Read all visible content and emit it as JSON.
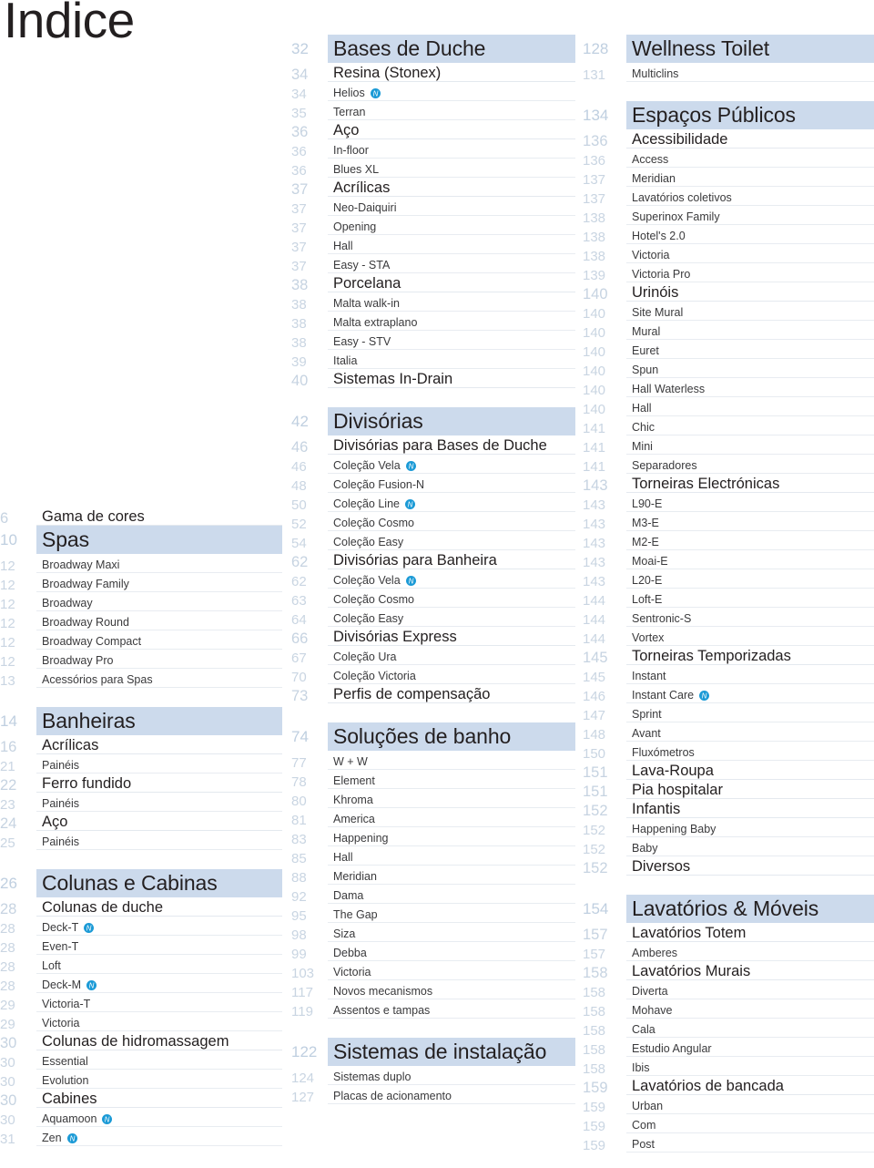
{
  "header": {
    "title": "Índice"
  },
  "theme": {
    "section_bar_color": "#ccdaec",
    "page_number_color": "#c6d3e1",
    "text_color": "#231f20",
    "rule_color": "#e6eaf0",
    "badge_color": "#1b9ad6",
    "badge_label": "N"
  },
  "columns": [
    {
      "name": "column-left",
      "rows": [
        {
          "type": "sub",
          "page": "6",
          "label": "Gama de cores",
          "size": "section-plain"
        },
        {
          "type": "section",
          "page": "10",
          "label": "Spas"
        },
        {
          "type": "item",
          "page": "12",
          "label": "Broadway Maxi"
        },
        {
          "type": "item",
          "page": "12",
          "label": "Broadway Family"
        },
        {
          "type": "item",
          "page": "12",
          "label": "Broadway"
        },
        {
          "type": "item",
          "page": "12",
          "label": "Broadway Round"
        },
        {
          "type": "item",
          "page": "12",
          "label": "Broadway Compact"
        },
        {
          "type": "item",
          "page": "12",
          "label": "Broadway Pro"
        },
        {
          "type": "item",
          "page": "13",
          "label": "Acessórios para Spas"
        },
        {
          "type": "gap"
        },
        {
          "type": "section",
          "page": "14",
          "label": "Banheiras"
        },
        {
          "type": "sub",
          "page": "16",
          "label": "Acrílicas"
        },
        {
          "type": "item",
          "page": "21",
          "label": "Painéis"
        },
        {
          "type": "sub",
          "page": "22",
          "label": "Ferro fundido"
        },
        {
          "type": "item",
          "page": "23",
          "label": "Painéis"
        },
        {
          "type": "sub",
          "page": "24",
          "label": "Aço"
        },
        {
          "type": "item",
          "page": "25",
          "label": "Painéis"
        },
        {
          "type": "gap"
        },
        {
          "type": "section",
          "page": "26",
          "label": "Colunas e Cabinas"
        },
        {
          "type": "sub",
          "page": "28",
          "label": "Colunas de duche"
        },
        {
          "type": "item",
          "page": "28",
          "label": "Deck-T",
          "badge": true
        },
        {
          "type": "item",
          "page": "28",
          "label": "Even-T"
        },
        {
          "type": "item",
          "page": "28",
          "label": "Loft"
        },
        {
          "type": "item",
          "page": "28",
          "label": "Deck-M",
          "badge": true
        },
        {
          "type": "item",
          "page": "29",
          "label": "Victoria-T"
        },
        {
          "type": "item",
          "page": "29",
          "label": "Victoria"
        },
        {
          "type": "sub",
          "page": "30",
          "label": "Colunas de hidromassagem"
        },
        {
          "type": "item",
          "page": "30",
          "label": "Essential"
        },
        {
          "type": "item",
          "page": "30",
          "label": "Evolution"
        },
        {
          "type": "sub",
          "page": "30",
          "label": "Cabines"
        },
        {
          "type": "item",
          "page": "30",
          "label": "Aquamoon",
          "badge": true
        },
        {
          "type": "item",
          "page": "31",
          "label": "Zen",
          "badge": true
        }
      ]
    },
    {
      "name": "column-middle",
      "rows": [
        {
          "type": "section",
          "page": "32",
          "label": "Bases de Duche"
        },
        {
          "type": "sub",
          "page": "34",
          "label": "Resina (Stonex)"
        },
        {
          "type": "item",
          "page": "34",
          "label": "Helios",
          "badge": true
        },
        {
          "type": "item",
          "page": "35",
          "label": "Terran"
        },
        {
          "type": "sub",
          "page": "36",
          "label": "Aço"
        },
        {
          "type": "item",
          "page": "36",
          "label": "In-floor"
        },
        {
          "type": "item",
          "page": "36",
          "label": "Blues XL"
        },
        {
          "type": "sub",
          "page": "37",
          "label": "Acrílicas"
        },
        {
          "type": "item",
          "page": "37",
          "label": "Neo-Daiquiri"
        },
        {
          "type": "item",
          "page": "37",
          "label": "Opening"
        },
        {
          "type": "item",
          "page": "37",
          "label": "Hall"
        },
        {
          "type": "item",
          "page": "37",
          "label": "Easy - STA"
        },
        {
          "type": "sub",
          "page": "38",
          "label": "Porcelana"
        },
        {
          "type": "item",
          "page": "38",
          "label": "Malta walk-in"
        },
        {
          "type": "item",
          "page": "38",
          "label": "Malta extraplano"
        },
        {
          "type": "item",
          "page": "38",
          "label": "Easy - STV"
        },
        {
          "type": "item",
          "page": "39",
          "label": "Italia"
        },
        {
          "type": "sub",
          "page": "40",
          "label": "Sistemas In-Drain"
        },
        {
          "type": "gap"
        },
        {
          "type": "section",
          "page": "42",
          "label": "Divisórias"
        },
        {
          "type": "sub",
          "page": "46",
          "label": "Divisórias para Bases de Duche"
        },
        {
          "type": "item",
          "page": "46",
          "label": "Coleção Vela",
          "badge": true
        },
        {
          "type": "item",
          "page": "48",
          "label": "Coleção Fusion-N"
        },
        {
          "type": "item",
          "page": "50",
          "label": "Coleção Line",
          "badge": true
        },
        {
          "type": "item",
          "page": "52",
          "label": "Coleção Cosmo"
        },
        {
          "type": "item",
          "page": "54",
          "label": "Coleção Easy"
        },
        {
          "type": "sub",
          "page": "62",
          "label": "Divisórias para Banheira"
        },
        {
          "type": "item",
          "page": "62",
          "label": "Coleção Vela",
          "badge": true
        },
        {
          "type": "item",
          "page": "63",
          "label": "Coleção Cosmo"
        },
        {
          "type": "item",
          "page": "64",
          "label": "Coleção Easy"
        },
        {
          "type": "sub",
          "page": "66",
          "label": "Divisórias Express"
        },
        {
          "type": "item",
          "page": "67",
          "label": "Coleção Ura"
        },
        {
          "type": "item",
          "page": "70",
          "label": "Coleção Victoria"
        },
        {
          "type": "sub",
          "page": "73",
          "label": "Perfis de compensação"
        },
        {
          "type": "gap"
        },
        {
          "type": "section",
          "page": "74",
          "label": "Soluções de banho"
        },
        {
          "type": "item",
          "page": "77",
          "label": "W + W"
        },
        {
          "type": "item",
          "page": "78",
          "label": "Element"
        },
        {
          "type": "item",
          "page": "80",
          "label": "Khroma"
        },
        {
          "type": "item",
          "page": "81",
          "label": "America"
        },
        {
          "type": "item",
          "page": "83",
          "label": "Happening"
        },
        {
          "type": "item",
          "page": "85",
          "label": "Hall"
        },
        {
          "type": "item",
          "page": "88",
          "label": "Meridian"
        },
        {
          "type": "item",
          "page": "92",
          "label": "Dama"
        },
        {
          "type": "item",
          "page": "95",
          "label": "The Gap"
        },
        {
          "type": "item",
          "page": "98",
          "label": "Siza"
        },
        {
          "type": "item",
          "page": "99",
          "label": "Debba"
        },
        {
          "type": "item",
          "page": "103",
          "label": "Victoria"
        },
        {
          "type": "item",
          "page": "117",
          "label": "Novos mecanismos"
        },
        {
          "type": "item",
          "page": "119",
          "label": "Assentos e tampas"
        },
        {
          "type": "gap"
        },
        {
          "type": "section",
          "page": "122",
          "label": "Sistemas de instalação"
        },
        {
          "type": "item",
          "page": "124",
          "label": "Sistemas duplo"
        },
        {
          "type": "item",
          "page": "127",
          "label": "Placas de acionamento"
        }
      ]
    },
    {
      "name": "column-right",
      "rows": [
        {
          "type": "section",
          "page": "128",
          "label": "Wellness Toilet"
        },
        {
          "type": "item",
          "page": "131",
          "label": "Multiclins"
        },
        {
          "type": "gap"
        },
        {
          "type": "section",
          "page": "134",
          "label": "Espaços Públicos"
        },
        {
          "type": "sub",
          "page": "136",
          "label": "Acessibilidade"
        },
        {
          "type": "item",
          "page": "136",
          "label": "Access"
        },
        {
          "type": "item",
          "page": "137",
          "label": "Meridian"
        },
        {
          "type": "item",
          "page": "137",
          "label": "Lavatórios coletivos"
        },
        {
          "type": "item",
          "page": "138",
          "label": "Superinox Family"
        },
        {
          "type": "item",
          "page": "138",
          "label": "Hotel's 2.0"
        },
        {
          "type": "item",
          "page": "138",
          "label": "Victoria"
        },
        {
          "type": "item",
          "page": "139",
          "label": "Victoria Pro"
        },
        {
          "type": "sub",
          "page": "140",
          "label": "Urinóis"
        },
        {
          "type": "item",
          "page": "140",
          "label": "Site Mural"
        },
        {
          "type": "item",
          "page": "140",
          "label": "Mural"
        },
        {
          "type": "item",
          "page": "140",
          "label": "Euret"
        },
        {
          "type": "item",
          "page": "140",
          "label": "Spun"
        },
        {
          "type": "item",
          "page": "140",
          "label": "Hall Waterless"
        },
        {
          "type": "item",
          "page": "140",
          "label": "Hall"
        },
        {
          "type": "item",
          "page": "141",
          "label": "Chic"
        },
        {
          "type": "item",
          "page": "141",
          "label": "Mini"
        },
        {
          "type": "item",
          "page": "141",
          "label": "Separadores"
        },
        {
          "type": "sub",
          "page": "143",
          "label": "Torneiras Electrónicas"
        },
        {
          "type": "item",
          "page": "143",
          "label": "L90-E"
        },
        {
          "type": "item",
          "page": "143",
          "label": "M3-E"
        },
        {
          "type": "item",
          "page": "143",
          "label": "M2-E"
        },
        {
          "type": "item",
          "page": "143",
          "label": "Moai-E"
        },
        {
          "type": "item",
          "page": "143",
          "label": "L20-E"
        },
        {
          "type": "item",
          "page": "144",
          "label": "Loft-E"
        },
        {
          "type": "item",
          "page": "144",
          "label": "Sentronic-S"
        },
        {
          "type": "item",
          "page": "144",
          "label": "Vortex"
        },
        {
          "type": "sub",
          "page": "145",
          "label": "Torneiras Temporizadas"
        },
        {
          "type": "item",
          "page": "145",
          "label": "Instant"
        },
        {
          "type": "item",
          "page": "146",
          "label": "Instant Care",
          "badge": true
        },
        {
          "type": "item",
          "page": "147",
          "label": "Sprint"
        },
        {
          "type": "item",
          "page": "148",
          "label": "Avant"
        },
        {
          "type": "item",
          "page": "150",
          "label": "Fluxómetros"
        },
        {
          "type": "sub",
          "page": "151",
          "label": "Lava-Roupa"
        },
        {
          "type": "sub",
          "page": "151",
          "label": "Pia hospitalar"
        },
        {
          "type": "sub",
          "page": "152",
          "label": "Infantis"
        },
        {
          "type": "item",
          "page": "152",
          "label": "Happening Baby"
        },
        {
          "type": "item",
          "page": "152",
          "label": "Baby"
        },
        {
          "type": "sub",
          "page": "152",
          "label": "Diversos"
        },
        {
          "type": "gap"
        },
        {
          "type": "section",
          "page": "154",
          "label": "Lavatórios & Móveis"
        },
        {
          "type": "sub",
          "page": "157",
          "label": "Lavatórios Totem"
        },
        {
          "type": "item",
          "page": "157",
          "label": "Amberes"
        },
        {
          "type": "sub",
          "page": "158",
          "label": "Lavatórios Murais"
        },
        {
          "type": "item",
          "page": "158",
          "label": "Diverta"
        },
        {
          "type": "item",
          "page": "158",
          "label": "Mohave"
        },
        {
          "type": "item",
          "page": "158",
          "label": "Cala"
        },
        {
          "type": "item",
          "page": "158",
          "label": "Estudio Angular"
        },
        {
          "type": "item",
          "page": "158",
          "label": "Ibis"
        },
        {
          "type": "sub",
          "page": "159",
          "label": "Lavatórios de bancada"
        },
        {
          "type": "item",
          "page": "159",
          "label": "Urban"
        },
        {
          "type": "item",
          "page": "159",
          "label": "Com"
        },
        {
          "type": "item",
          "page": "159",
          "label": "Post"
        }
      ]
    }
  ]
}
